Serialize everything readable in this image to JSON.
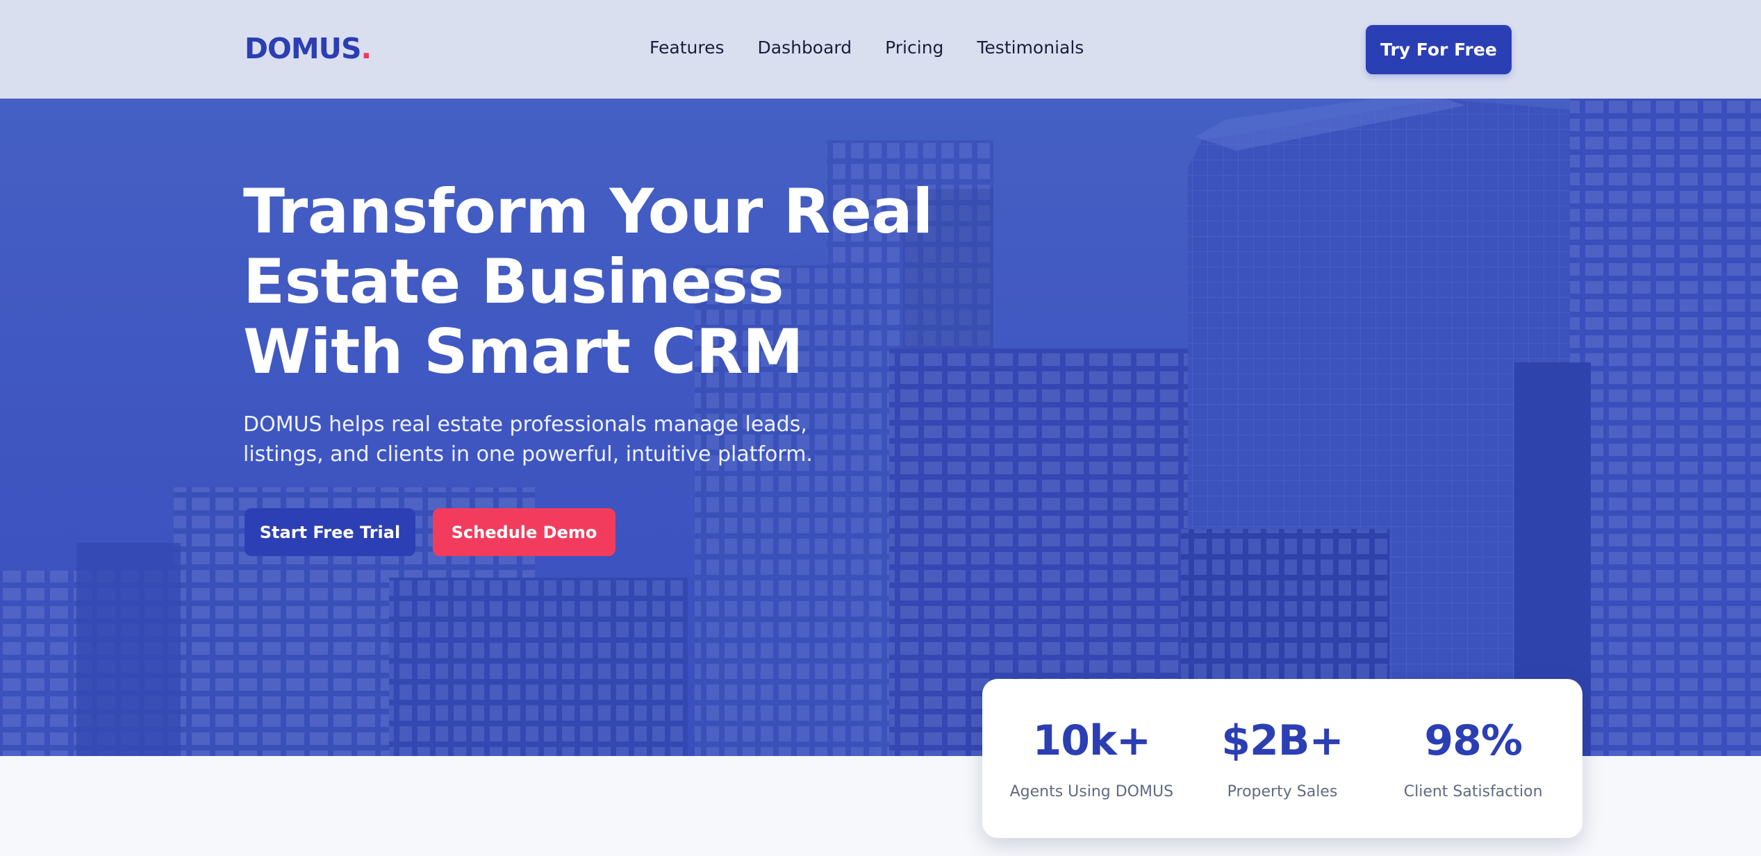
{
  "header": {
    "logo_text": "DOMUS",
    "logo_dot": ".",
    "nav": [
      {
        "label": "Features"
      },
      {
        "label": "Dashboard"
      },
      {
        "label": "Pricing"
      },
      {
        "label": "Testimonials"
      }
    ],
    "cta_label": "Try For Free"
  },
  "hero": {
    "title": "Transform Your Real Estate Business With Smart CRM",
    "subtitle": "DOMUS helps real estate professionals manage leads, listings, and clients in one powerful, intuitive platform.",
    "primary_button": "Start Free Trial",
    "secondary_button": "Schedule Demo"
  },
  "stats": [
    {
      "value": "10k+",
      "label": "Agents Using DOMUS"
    },
    {
      "value": "$2B+",
      "label": "Property Sales"
    },
    {
      "value": "98%",
      "label": "Client Satisfaction"
    }
  ],
  "colors": {
    "brand": "#2b3eb3",
    "accent": "#f33c5d",
    "hero_overlay": "#4158c2",
    "navbar_bg": "#dadff0"
  }
}
